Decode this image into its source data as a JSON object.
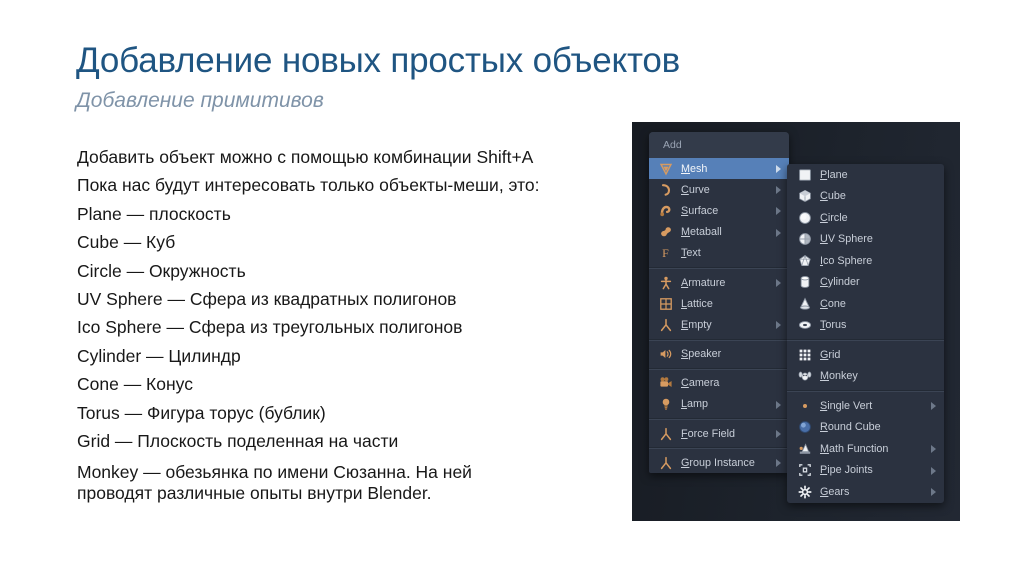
{
  "slide": {
    "title": "Добавление новых простых объектов",
    "subtitle": "Добавление примитивов",
    "title_color": "#1f5582",
    "subtitle_color": "#7f93a8",
    "body_lines": [
      "Добавить объект можно с помощью комбинации Shift+A",
      "Пока нас будут интересовать только объекты-меши, это:",
      "Plane — плоскость",
      "Cube — Куб",
      "Circle — Окружность",
      "UV Sphere — Сфера из квадратных полигонов",
      "Ico Sphere — Сфера из треугольных полигонов",
      "Cylinder — Цилиндр",
      "Cone — Конус",
      "Torus — Фигура торус (бублик)",
      "Grid — Плоскость поделенная на части"
    ],
    "last_paragraph": "Monkey — обезьянка по имени Сюзанна. На ней\nпроводят различные опыты внутри Blender."
  },
  "blender": {
    "panel_background": "#1a1f27",
    "menu_background": "#2b3240",
    "highlight_color": "#5680b8",
    "icon_color": "#d79b61",
    "add_menu": {
      "header": "Add",
      "groups": [
        {
          "items": [
            {
              "label": "Mesh",
              "icon": "mesh-cone-icon",
              "arrow": true,
              "selected": true
            },
            {
              "label": "Curve",
              "icon": "curve-icon",
              "arrow": true,
              "selected": false
            },
            {
              "label": "Surface",
              "icon": "surface-icon",
              "arrow": true,
              "selected": false
            },
            {
              "label": "Metaball",
              "icon": "metaball-icon",
              "arrow": true,
              "selected": false
            },
            {
              "label": "Text",
              "icon": "text-f-icon",
              "arrow": false,
              "selected": false
            }
          ]
        },
        {
          "items": [
            {
              "label": "Armature",
              "icon": "armature-icon",
              "arrow": true,
              "selected": false
            },
            {
              "label": "Lattice",
              "icon": "lattice-icon",
              "arrow": false,
              "selected": false
            },
            {
              "label": "Empty",
              "icon": "empty-axes-icon",
              "arrow": true,
              "selected": false
            }
          ]
        },
        {
          "items": [
            {
              "label": "Speaker",
              "icon": "speaker-icon",
              "arrow": false,
              "selected": false
            }
          ]
        },
        {
          "items": [
            {
              "label": "Camera",
              "icon": "camera-icon",
              "arrow": false,
              "selected": false
            },
            {
              "label": "Lamp",
              "icon": "lamp-icon",
              "arrow": true,
              "selected": false
            }
          ]
        },
        {
          "items": [
            {
              "label": "Force Field",
              "icon": "force-field-icon",
              "arrow": true,
              "selected": false
            }
          ]
        },
        {
          "items": [
            {
              "label": "Group Instance",
              "icon": "group-instance-icon",
              "arrow": true,
              "selected": false
            }
          ]
        }
      ]
    },
    "mesh_submenu": {
      "groups": [
        {
          "items": [
            {
              "label": "Plane",
              "icon": "plane-mesh-icon",
              "arrow": false
            },
            {
              "label": "Cube",
              "icon": "cube-mesh-icon",
              "arrow": false
            },
            {
              "label": "Circle",
              "icon": "circle-mesh-icon",
              "arrow": false
            },
            {
              "label": "UV Sphere",
              "icon": "uv-sphere-mesh-icon",
              "arrow": false
            },
            {
              "label": "Ico Sphere",
              "icon": "ico-sphere-mesh-icon",
              "arrow": false
            },
            {
              "label": "Cylinder",
              "icon": "cylinder-mesh-icon",
              "arrow": false
            },
            {
              "label": "Cone",
              "icon": "cone-mesh-icon",
              "arrow": false
            },
            {
              "label": "Torus",
              "icon": "torus-mesh-icon",
              "arrow": false
            }
          ]
        },
        {
          "items": [
            {
              "label": "Grid",
              "icon": "grid-mesh-icon",
              "arrow": false
            },
            {
              "label": "Monkey",
              "icon": "monkey-mesh-icon",
              "arrow": false
            }
          ]
        },
        {
          "items": [
            {
              "label": "Single Vert",
              "icon": "single-vert-icon",
              "arrow": true
            },
            {
              "label": "Round Cube",
              "icon": "round-cube-icon",
              "arrow": false
            },
            {
              "label": "Math Function",
              "icon": "math-function-icon",
              "arrow": true
            },
            {
              "label": "Pipe Joints",
              "icon": "pipe-joints-icon",
              "arrow": true
            },
            {
              "label": "Gears",
              "icon": "gears-icon",
              "arrow": true
            }
          ]
        }
      ]
    }
  }
}
